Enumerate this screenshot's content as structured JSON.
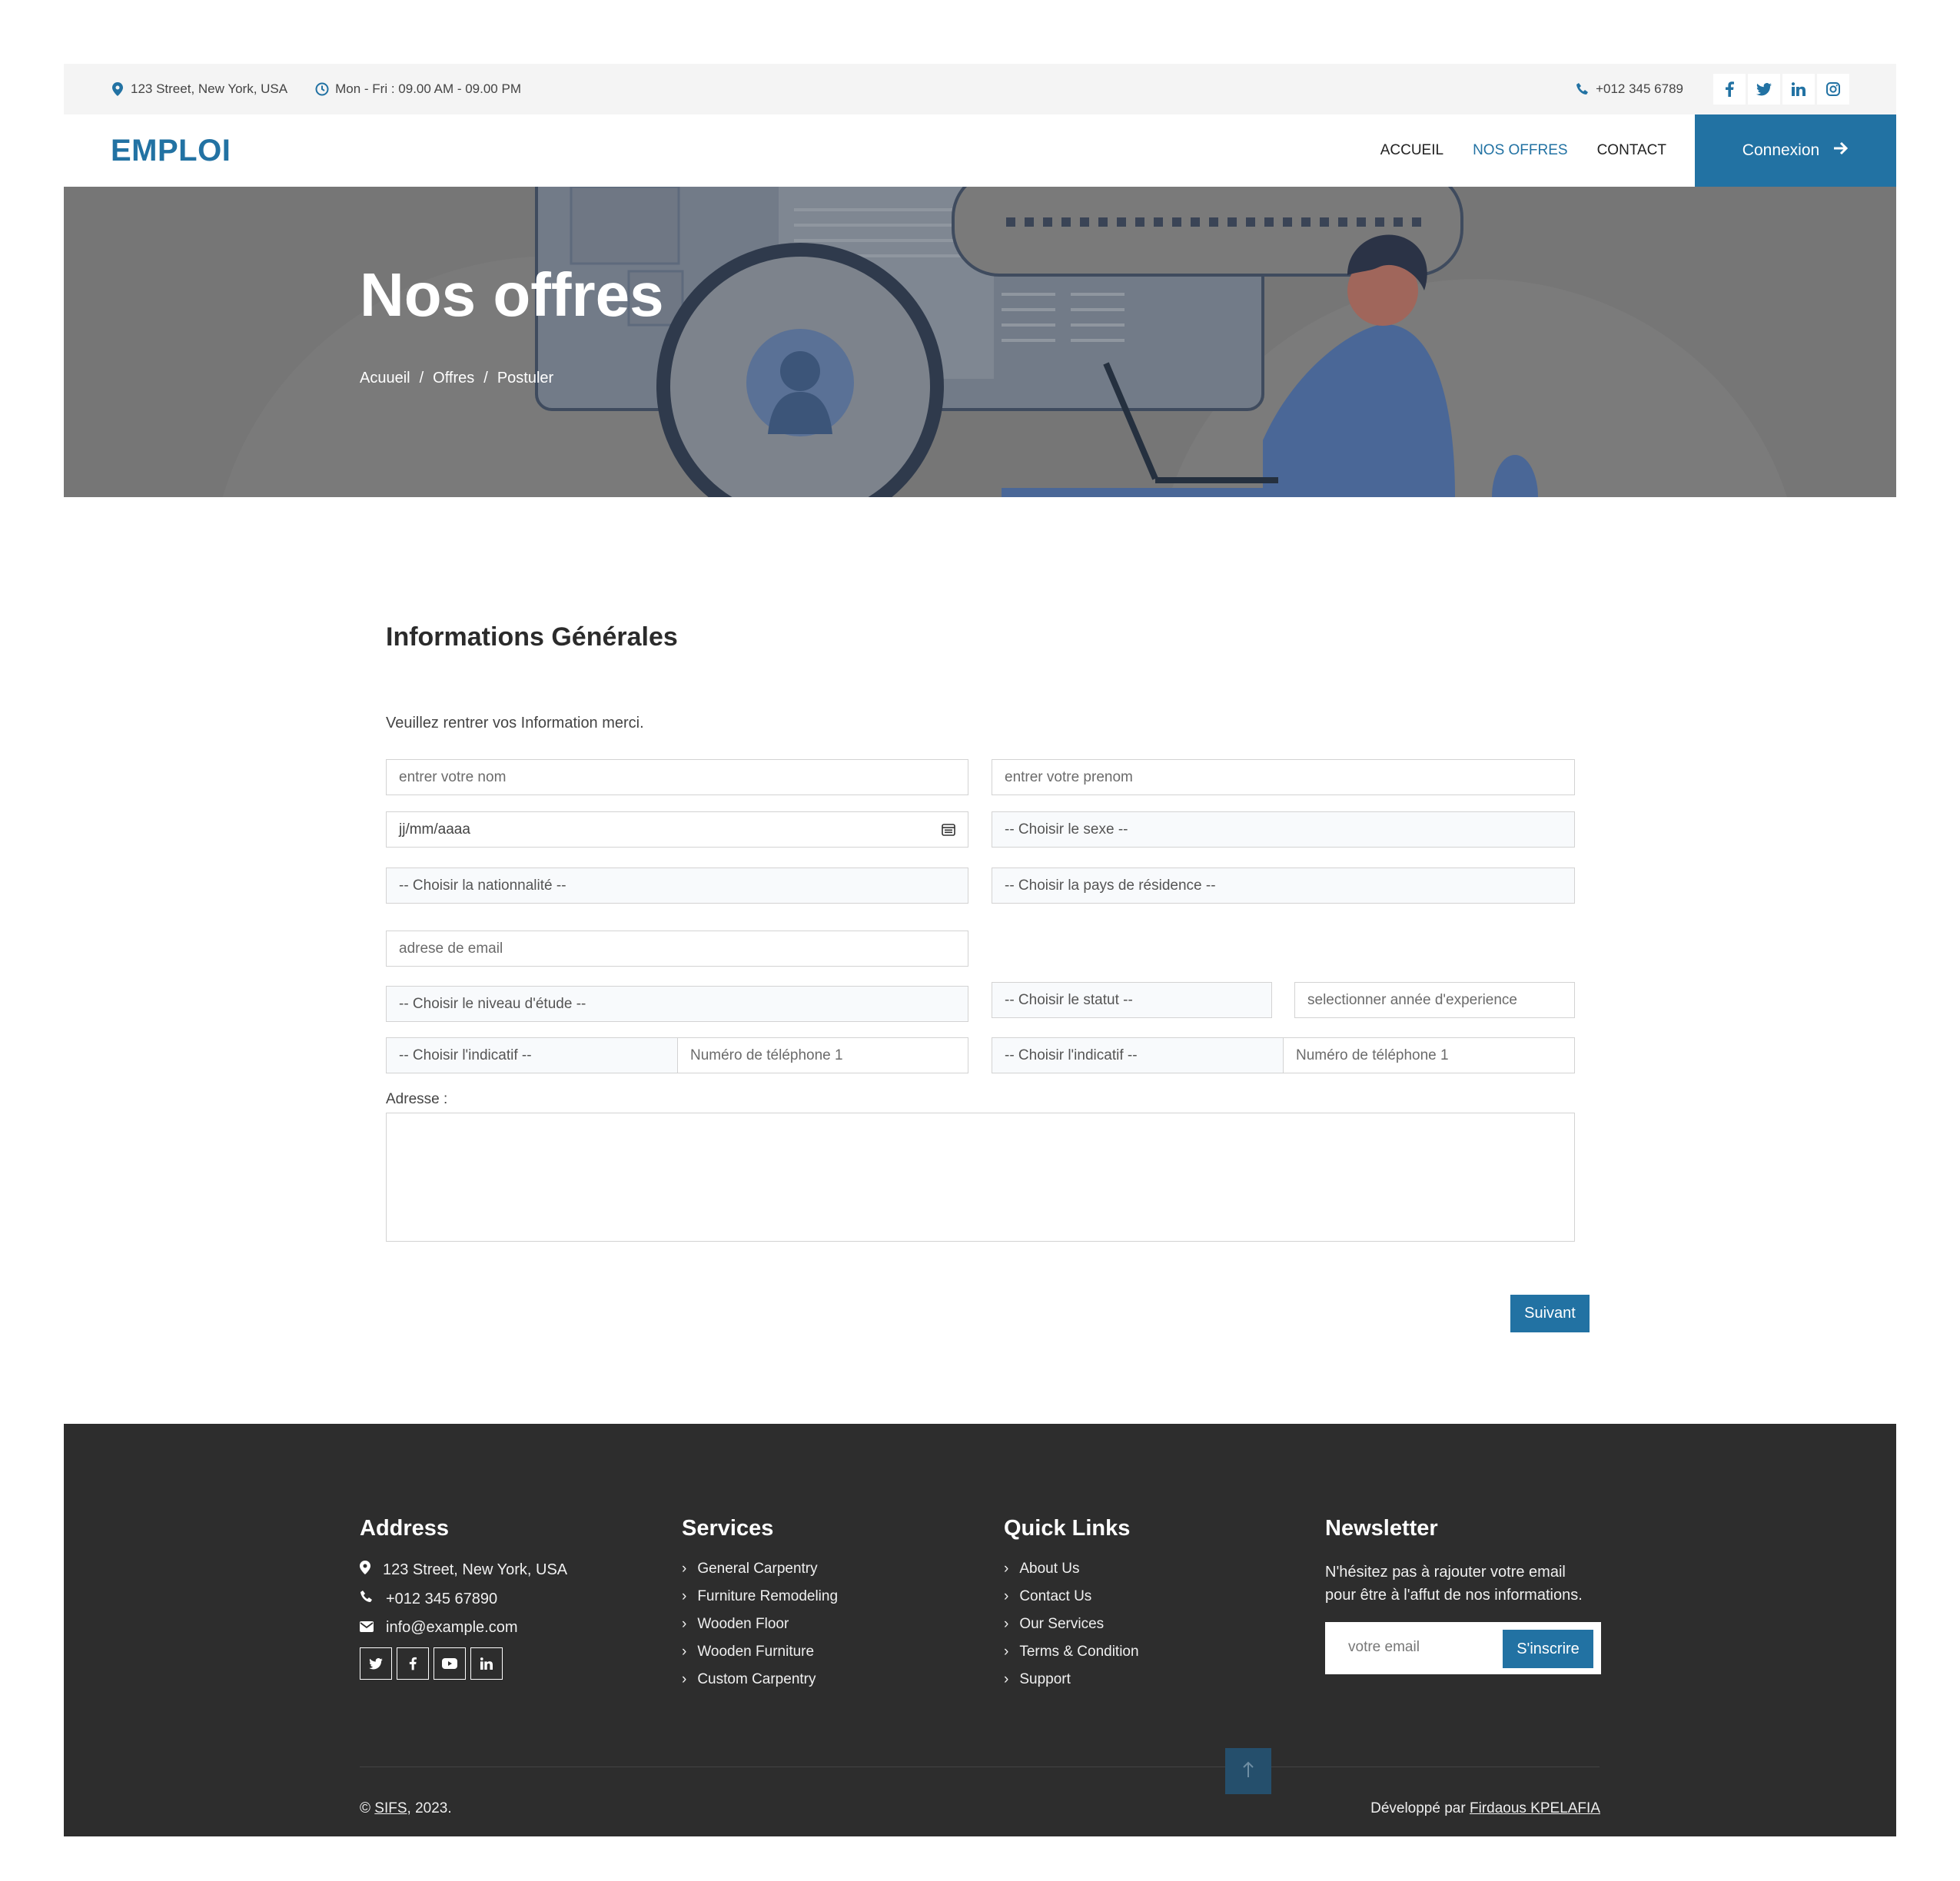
{
  "topbar": {
    "address": "123 Street, New York, USA",
    "hours": "Mon - Fri : 09.00 AM - 09.00 PM",
    "phone": "+012 345 6789",
    "social": [
      "facebook-icon",
      "twitter-icon",
      "linkedin-icon",
      "instagram-icon"
    ]
  },
  "nav": {
    "brand": "EMPLOI",
    "links": [
      {
        "label": "ACCUEIL",
        "active": false
      },
      {
        "label": "NOS OFFRES",
        "active": true
      },
      {
        "label": "CONTACT",
        "active": false
      }
    ],
    "cta": "Connexion"
  },
  "hero": {
    "title": "Nos offres",
    "breadcrumb": [
      "Acuueil",
      "Offres",
      "Postuler"
    ]
  },
  "form": {
    "title": "Informations Générales",
    "subtitle": "Veuillez rentrer vos Information merci.",
    "nom_placeholder": "entrer votre nom",
    "prenom_placeholder": "entrer votre prenom",
    "date_placeholder": "jj/mm/aaaa",
    "sexe": "-- Choisir le sexe --",
    "nationalite": "-- Choisir la nationnalité --",
    "pays": "-- Choisir la pays de résidence --",
    "email_placeholder": "adrese de email",
    "niveau": "-- Choisir le niveau d'étude --",
    "statut": "-- Choisir le statut --",
    "experience_placeholder": "selectionner année d'experience",
    "indicatif1": "-- Choisir l'indicatif --",
    "tel1_placeholder": "Numéro de téléphone 1",
    "indicatif2": "-- Choisir l'indicatif --",
    "tel2_placeholder": "Numéro de téléphone 1",
    "adresse_label": "Adresse :",
    "next": "Suivant"
  },
  "footer": {
    "address": {
      "title": "Address",
      "street": "123 Street, New York, USA",
      "phone": "+012 345 67890",
      "email": "info@example.com"
    },
    "services": {
      "title": "Services",
      "items": [
        "General Carpentry",
        "Furniture Remodeling",
        "Wooden Floor",
        "Wooden Furniture",
        "Custom Carpentry"
      ]
    },
    "quick_links": {
      "title": "Quick Links",
      "items": [
        "About Us",
        "Contact Us",
        "Our Services",
        "Terms & Condition",
        "Support"
      ]
    },
    "newsletter": {
      "title": "Newsletter",
      "text": "N'hésitez pas à rajouter votre email pour être à l'affut de nos informations.",
      "placeholder": "votre email",
      "button": "S'inscrire"
    },
    "copyright_prefix": "©",
    "copyright_link": "SIFS",
    "copyright_suffix": ", 2023.",
    "dev_prefix": "Développé par",
    "dev_name": "Firdaous KPELAFIA"
  },
  "colors": {
    "accent": "#2272a3",
    "footer_bg": "#2d2d2d",
    "hero_bg": "#767676"
  }
}
